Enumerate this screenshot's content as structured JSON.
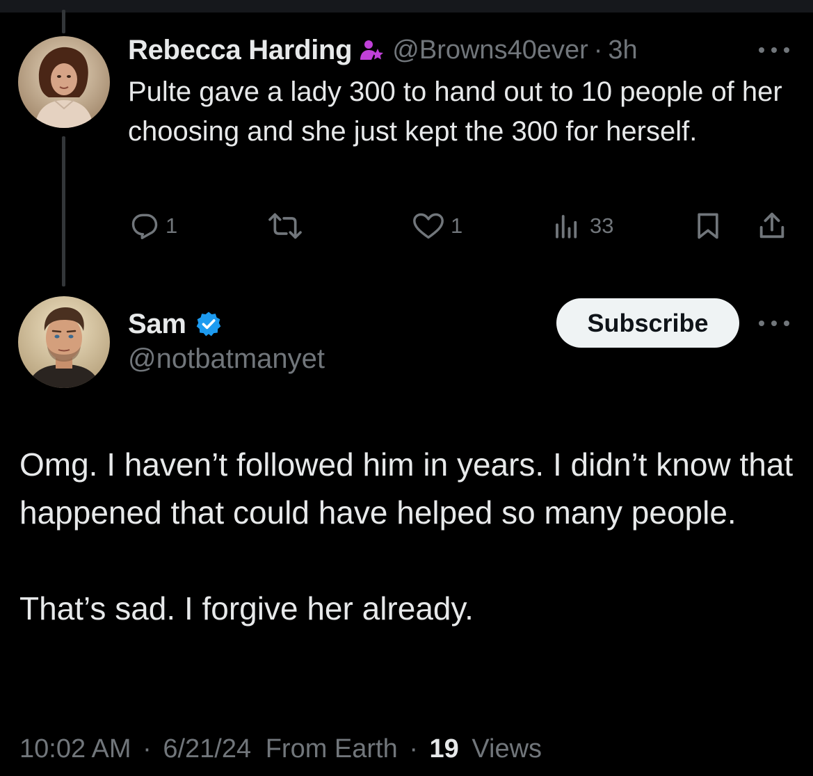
{
  "reply": {
    "display_name": "Rebecca Harding",
    "handle": "@Browns40ever",
    "separator": "·",
    "time": "3h",
    "text": "Pulte gave a lady 300 to hand out to 10 people of her choosing and she just kept the 300 for herself.",
    "actions": {
      "replies": "1",
      "likes": "1",
      "views": "33"
    }
  },
  "post": {
    "display_name": "Sam",
    "handle": "@notbatmanyet",
    "subscribe_label": "Subscribe",
    "paragraphs": [
      "Omg. I haven’t followed him in years. I didn’t know that happened that could have helped so many people.",
      "That’s sad. I forgive her already."
    ],
    "meta": {
      "time": "10:02 AM",
      "date": "6/21/24",
      "location": "From Earth",
      "separator": "·",
      "views_count": "19",
      "views_label": "Views"
    }
  },
  "colors": {
    "background": "#000000",
    "text_primary": "#e7e9ea",
    "text_secondary": "#71767b",
    "verified_blue": "#1d9bf0",
    "parody_badge": "#c040d8",
    "button_bg": "#eff3f4"
  },
  "icons": [
    "parody-badge-icon",
    "more-icon",
    "reply-icon",
    "repost-icon",
    "like-icon",
    "views-icon",
    "bookmark-icon",
    "share-icon",
    "verified-badge-icon"
  ]
}
